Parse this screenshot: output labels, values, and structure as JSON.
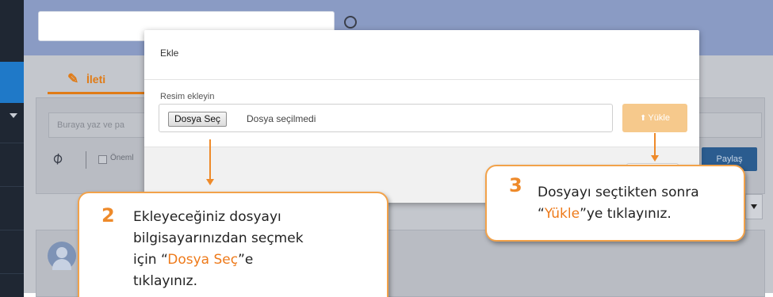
{
  "background": {
    "tab_label": "İleti",
    "composer_placeholder": "Buraya yaz ve pa",
    "important_label": "Öneml",
    "share_label": "Paylaş"
  },
  "modal": {
    "title": "Ekle",
    "field_label": "Resim ekleyin",
    "choose_file_label": "Dosya Seç",
    "file_status": "Dosya seçilmedi",
    "upload_label": "Yükle"
  },
  "callouts": {
    "step2": {
      "number": "2",
      "line1": "Ekleyeceğiniz dosyayı",
      "line2": "bilgisayarınızdan seçmek",
      "line3_pre": "için “",
      "line3_hl": "Dosya Seç",
      "line3_post": "”e",
      "line4": "tıklayınız."
    },
    "step3": {
      "number": "3",
      "line1": "Dosyayı seçtikten sonra",
      "line2_pre": "“",
      "line2_hl": "Yükle",
      "line2_post": "”ye tıklayınız."
    }
  },
  "colors": {
    "accent_orange": "#ee8a2a",
    "upload_button": "#f6c98c",
    "share_button": "#2b5c8f",
    "topbar": "#8a9bc4"
  },
  "icons": {
    "search": "search-icon",
    "edit": "edit-icon",
    "attach": "paperclip-icon",
    "upload": "upload-icon",
    "avatar": "user-avatar-icon"
  }
}
